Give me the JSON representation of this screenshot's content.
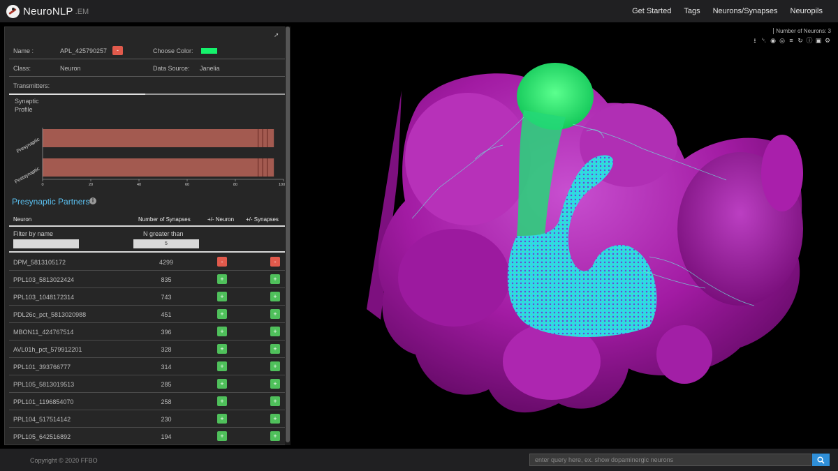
{
  "brand": {
    "name": "NeuroNLP",
    "suffix": ".EM"
  },
  "nav": {
    "items": [
      "Get Started",
      "Tags",
      "Neurons/Synapses",
      "Neuropils"
    ]
  },
  "info": {
    "name_label": "Name :",
    "name_value": "APL_425790257",
    "remove_label": "-",
    "color_label": "Choose Color:",
    "color_value": "#15f26c",
    "class_label": "Class:",
    "class_value": "Neuron",
    "source_label": "Data Source:",
    "source_value": "Janelia",
    "transmitters_label": "Transmitters:",
    "synaptic_profile_label_1": "Synaptic",
    "synaptic_profile_label_2": "Profile"
  },
  "chart_data": {
    "type": "bar",
    "orientation": "horizontal",
    "stacked": true,
    "categories": [
      "Presynaptic",
      "Postsynaptic"
    ],
    "xlim": [
      0,
      100
    ],
    "xticks": [
      "0",
      "20",
      "40",
      "60",
      "80",
      "100%"
    ],
    "values": [
      96,
      96
    ],
    "bar_color": "#a35a50"
  },
  "partners": {
    "title": "Presynaptic Partners",
    "columns": {
      "neuron": "Neuron",
      "synapses": "Number of Synapses",
      "plus_minus_neuron": "+/- Neuron",
      "plus_minus_synapses": "+/- Synapses"
    },
    "filter_label": "Filter by name",
    "n_label": "N greater than",
    "n_value": "5",
    "rows": [
      {
        "name": "DPM_5813105172",
        "count": "4299",
        "state": "-"
      },
      {
        "name": "PPL103_5813022424",
        "count": "835",
        "state": "+"
      },
      {
        "name": "PPL103_1048172314",
        "count": "743",
        "state": "+"
      },
      {
        "name": "PDL26c_pct_5813020988",
        "count": "451",
        "state": "+"
      },
      {
        "name": "MBON11_424767514",
        "count": "396",
        "state": "+"
      },
      {
        "name": "AVL01h_pct_579912201",
        "count": "328",
        "state": "+"
      },
      {
        "name": "PPL101_393766777",
        "count": "314",
        "state": "+"
      },
      {
        "name": "PPL105_5813019513",
        "count": "285",
        "state": "+"
      },
      {
        "name": "PPL101_1196854070",
        "count": "258",
        "state": "+"
      },
      {
        "name": "PPL104_517514142",
        "count": "230",
        "state": "+"
      },
      {
        "name": "PPL105_642516892",
        "count": "194",
        "state": "+"
      }
    ]
  },
  "viewport": {
    "num_neurons": "Number of Neurons: 3",
    "tools": [
      "download-icon",
      "trash-icon",
      "eye-slash-icon",
      "eye-icon",
      "list-icon",
      "refresh-icon",
      "info-icon",
      "camera-icon",
      "gear-icon"
    ],
    "neuropil_color": "#b21fb0",
    "neuron_colors": [
      "#15f26c",
      "#2ad6f0"
    ]
  },
  "footer": {
    "copyright": "Copyright © 2020 FFBO",
    "query_placeholder": "enter query here, ex. show dopaminergic neurons"
  }
}
